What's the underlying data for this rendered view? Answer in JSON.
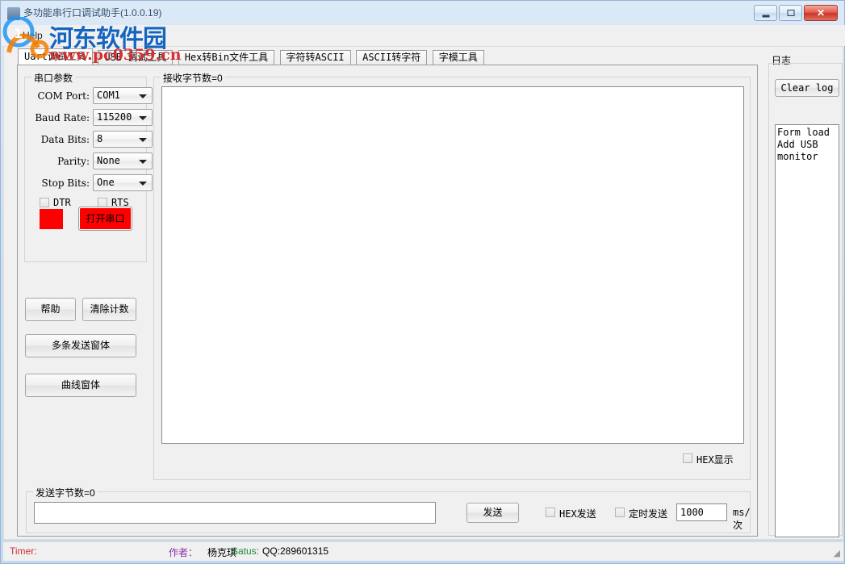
{
  "window": {
    "title": "多功能串行口调试助手(1.0.0.19)",
    "minimize_label": "",
    "maximize_label": "",
    "close_label": "✕"
  },
  "menu": {
    "help": "Help"
  },
  "watermark": {
    "site_name": "河东软件园",
    "url": "www.pc0359.cn"
  },
  "tabs": [
    {
      "label": "Uart调试工具",
      "active": true
    },
    {
      "label": "USB 调试工具",
      "active": false
    },
    {
      "label": "Hex转Bin文件工具",
      "active": false
    },
    {
      "label": "字符转ASCII",
      "active": false
    },
    {
      "label": "ASCII转字符",
      "active": false
    },
    {
      "label": "字模工具",
      "active": false
    }
  ],
  "serial_params": {
    "group_title": "串口参数",
    "com_port": {
      "label": "COM Port:",
      "value": "COM1"
    },
    "baud_rate": {
      "label": "Baud Rate:",
      "value": "115200"
    },
    "data_bits": {
      "label": "Data Bits:",
      "value": "8"
    },
    "parity": {
      "label": "Parity:",
      "value": "None"
    },
    "stop_bits": {
      "label": "Stop Bits:",
      "value": "One"
    },
    "dtr": {
      "label": "DTR",
      "checked": false
    },
    "rts": {
      "label": "RTS",
      "checked": false
    },
    "indicator_color": "#ff0000",
    "open_button": {
      "label": "打开串口",
      "color": "#ff0000"
    }
  },
  "actions": {
    "help": "帮助",
    "clear_count": "清除计数",
    "multi_send_window": "多条发送窗体",
    "curve_window": "曲线窗体"
  },
  "receive": {
    "group_title": "接收字节数=0",
    "content": "",
    "hex_display": {
      "label": "HEX显示",
      "checked": false
    }
  },
  "send": {
    "group_title": "发送字节数=0",
    "input_value": "",
    "send_button": "发送",
    "hex_send": {
      "label": "HEX发送",
      "checked": false
    },
    "timed_send": {
      "label": "定时发送",
      "checked": false
    },
    "interval_value": "1000",
    "interval_unit": "ms/次"
  },
  "log": {
    "title": "日志",
    "clear_button": "Clear log",
    "content": "Form load\nAdd USB monitor"
  },
  "statusbar": {
    "timer": "Timer:",
    "author_label": "作者：",
    "author_value": "杨克琪",
    "status_label": "Satus:",
    "status_value": "QQ:289601315"
  }
}
